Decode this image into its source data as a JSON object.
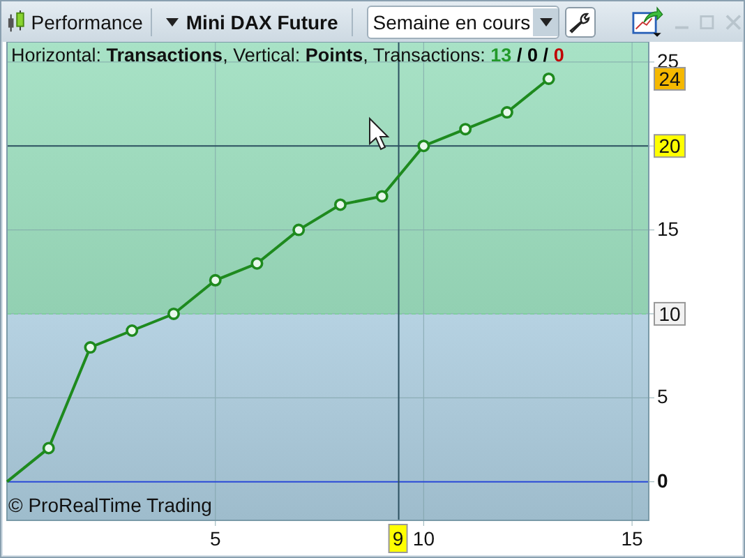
{
  "toolbar": {
    "title": "Performance",
    "instrument": "Mini DAX Future",
    "period": {
      "value": "Semaine en cours"
    }
  },
  "info": [
    {
      "text": "Horizontal: **Transactions**, Vertical: **Points**, Transactions:"
    },
    {
      "text": "13",
      "color": "#22992a"
    },
    {
      "text": "/",
      "color": "#000000"
    },
    {
      "text": "0",
      "color": "#000000"
    },
    {
      "text": "/",
      "color": "#000000"
    },
    {
      "text": "0",
      "color": "#c00000"
    }
  ],
  "chart": {
    "chart_data": {
      "type": "line",
      "x": [
        0,
        1,
        2,
        3,
        4,
        5,
        6,
        7,
        8,
        9,
        10,
        11,
        12,
        13
      ],
      "series": [
        {
          "color": "#1e8a1e",
          "marker": "circle",
          "values": [
            0,
            2,
            8,
            9,
            10,
            12,
            13,
            15,
            16.5,
            17,
            20,
            21,
            22,
            24
          ]
        }
      ],
      "grid": true,
      "xlim": [
        0,
        15.4
      ],
      "ylim": [
        -2.3,
        26.2
      ],
      "xticks": [
        5,
        10,
        15
      ],
      "yticks": [
        0,
        5,
        10,
        15,
        20,
        25
      ],
      "ref_lines": [
        {
          "axis": "y",
          "value": 10,
          "label": "10"
        },
        {
          "axis": "y",
          "value": 0
        },
        {
          "axis": "x",
          "value": 9.4,
          "label": "9"
        },
        {
          "axis": "y",
          "value": 20,
          "label": "20"
        }
      ],
      "annotations": [
        "24"
      ]
    },
    "copyright": "© ProRealTime Trading"
  }
}
